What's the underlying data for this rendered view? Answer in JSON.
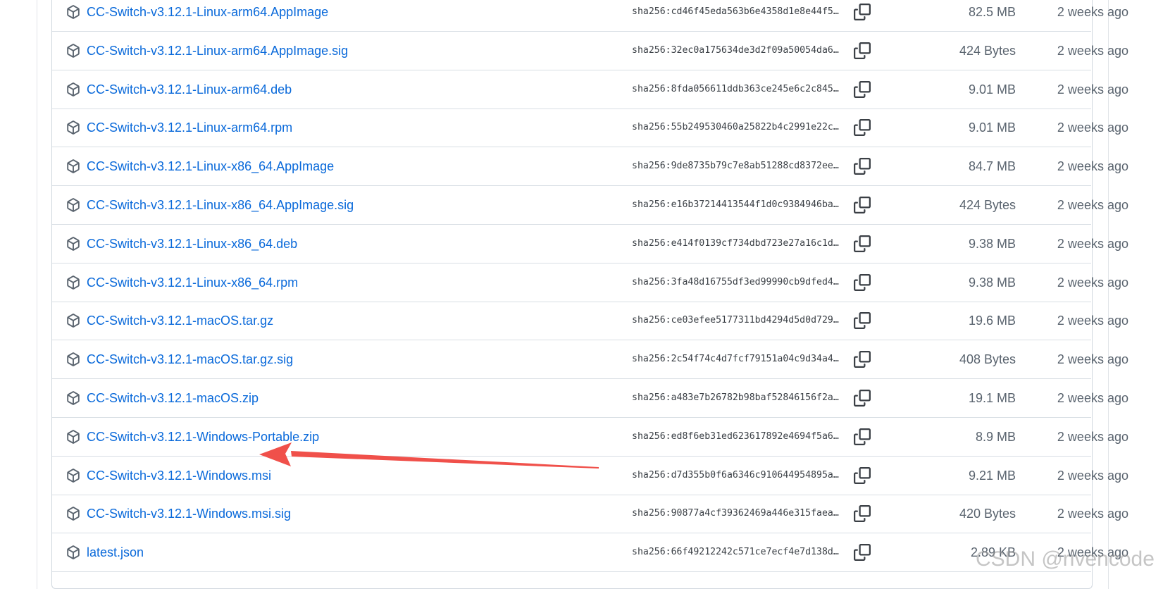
{
  "assets": [
    {
      "name": "CC-Switch-v3.12.1-Linux-arm64.AppImage",
      "digest": "sha256:cd46f45eda563b6e4358d1e8e44f5…",
      "size": "82.5 MB",
      "updated": "2 weeks ago"
    },
    {
      "name": "CC-Switch-v3.12.1-Linux-arm64.AppImage.sig",
      "digest": "sha256:32ec0a175634de3d2f09a50054da6…",
      "size": "424 Bytes",
      "updated": "2 weeks ago"
    },
    {
      "name": "CC-Switch-v3.12.1-Linux-arm64.deb",
      "digest": "sha256:8fda056611ddb363ce245e6c2c845…",
      "size": "9.01 MB",
      "updated": "2 weeks ago"
    },
    {
      "name": "CC-Switch-v3.12.1-Linux-arm64.rpm",
      "digest": "sha256:55b249530460a25822b4c2991e22c…",
      "size": "9.01 MB",
      "updated": "2 weeks ago"
    },
    {
      "name": "CC-Switch-v3.12.1-Linux-x86_64.AppImage",
      "digest": "sha256:9de8735b79c7e8ab51288cd8372ee…",
      "size": "84.7 MB",
      "updated": "2 weeks ago"
    },
    {
      "name": "CC-Switch-v3.12.1-Linux-x86_64.AppImage.sig",
      "digest": "sha256:e16b37214413544f1d0c9384946ba…",
      "size": "424 Bytes",
      "updated": "2 weeks ago"
    },
    {
      "name": "CC-Switch-v3.12.1-Linux-x86_64.deb",
      "digest": "sha256:e414f0139cf734dbd723e27a16c1d…",
      "size": "9.38 MB",
      "updated": "2 weeks ago"
    },
    {
      "name": "CC-Switch-v3.12.1-Linux-x86_64.rpm",
      "digest": "sha256:3fa48d16755df3ed99990cb9dfed4…",
      "size": "9.38 MB",
      "updated": "2 weeks ago"
    },
    {
      "name": "CC-Switch-v3.12.1-macOS.tar.gz",
      "digest": "sha256:ce03efee5177311bd4294d5d0d729…",
      "size": "19.6 MB",
      "updated": "2 weeks ago"
    },
    {
      "name": "CC-Switch-v3.12.1-macOS.tar.gz.sig",
      "digest": "sha256:2c54f74c4d7fcf79151a04c9d34a4…",
      "size": "408 Bytes",
      "updated": "2 weeks ago"
    },
    {
      "name": "CC-Switch-v3.12.1-macOS.zip",
      "digest": "sha256:a483e7b26782b98baf52846156f2a…",
      "size": "19.1 MB",
      "updated": "2 weeks ago"
    },
    {
      "name": "CC-Switch-v3.12.1-Windows-Portable.zip",
      "digest": "sha256:ed8f6eb31ed623617892e4694f5a6…",
      "size": "8.9 MB",
      "updated": "2 weeks ago"
    },
    {
      "name": "CC-Switch-v3.12.1-Windows.msi",
      "digest": "sha256:d7d355b0f6a6346c910644954895a…",
      "size": "9.21 MB",
      "updated": "2 weeks ago"
    },
    {
      "name": "CC-Switch-v3.12.1-Windows.msi.sig",
      "digest": "sha256:90877a4cf39362469a446e315faea…",
      "size": "420 Bytes",
      "updated": "2 weeks ago"
    },
    {
      "name": "latest.json",
      "digest": "sha256:66f49212242c571ce7ecf4e7d138d…",
      "size": "2.89 KB",
      "updated": "2 weeks ago"
    }
  ],
  "icons": {
    "asset": "package-icon",
    "copy": "copy-icon"
  },
  "colors": {
    "link": "#0969da",
    "muted": "#59636e",
    "annotation_arrow": "#f0504a"
  },
  "annotation": {
    "highlighted_asset": "CC-Switch-v3.12.1-Windows.msi"
  },
  "watermark": "CSDN @rivencode"
}
